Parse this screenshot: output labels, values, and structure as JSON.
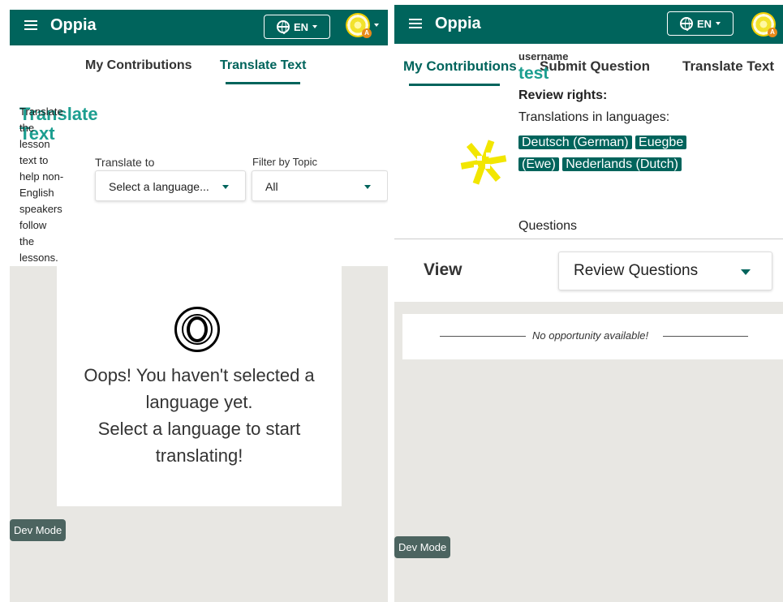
{
  "left": {
    "topbar": {
      "logo": "Oppia",
      "lang_label": "EN"
    },
    "tabs": [
      {
        "label": "My Contributions"
      },
      {
        "label": "Translate Text"
      }
    ],
    "intro": {
      "title": "Translate Text",
      "description_lines": [
        "Translate",
        "the",
        "lesson",
        "text to",
        "help non-",
        "English",
        "speakers",
        "follow",
        "the",
        "lessons."
      ]
    },
    "translate_to": {
      "label": "Translate to",
      "value": "Select a language..."
    },
    "filter_topic": {
      "label": "Filter by Topic",
      "value": "All"
    },
    "empty_state": {
      "line1": "Oops! You haven't selected a",
      "line2": "language yet.",
      "line3": "Select a language to start",
      "line4": "translating!"
    },
    "dev_mode": "Dev Mode"
  },
  "right": {
    "topbar": {
      "logo": "Oppia",
      "lang_label": "EN"
    },
    "tabs": [
      {
        "label": "My Contributions"
      },
      {
        "label": "Submit Question"
      },
      {
        "label": "Translate Text"
      }
    ],
    "profile": {
      "username_label": "username",
      "username": "test",
      "review_rights_label": "Review rights:",
      "translations_label": "Translations in languages:",
      "languages": [
        "Deutsch (German)",
        "Euegbe",
        "(Ewe)",
        "Nederlands (Dutch)"
      ],
      "questions_label": "Questions"
    },
    "view": {
      "label": "View",
      "select_value": "Review Questions"
    },
    "empty_message": "No opportunity available!",
    "dev_mode": "Dev Mode"
  },
  "colors": {
    "primary": "#00645c",
    "background": "#e8e7e3",
    "chip": "#00645c"
  }
}
